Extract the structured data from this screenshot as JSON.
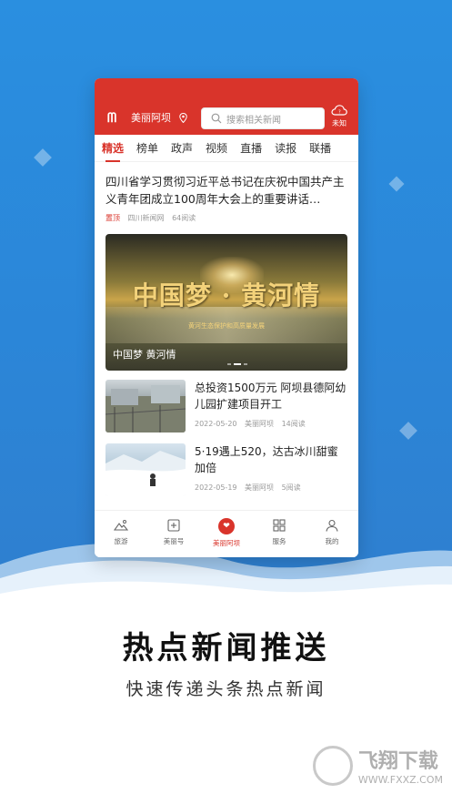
{
  "header": {
    "app_name": "美丽阿坝",
    "search_placeholder": "搜索相关新闻",
    "weather_label": "未知"
  },
  "tabs": [
    {
      "label": "精选",
      "active": true
    },
    {
      "label": "榜单"
    },
    {
      "label": "政声"
    },
    {
      "label": "视频"
    },
    {
      "label": "直播"
    },
    {
      "label": "读报"
    },
    {
      "label": "联播"
    }
  ],
  "top_news": {
    "title": "四川省学习贯彻习近平总书记在庆祝中国共产主义青年团成立100周年大会上的重要讲话…",
    "tag": "置顶",
    "source": "四川新闻网",
    "reads": "64阅读"
  },
  "banner": {
    "big_text": "中国梦 · 黄河情",
    "sub_text": "黄河生态保护和高质量发展",
    "caption": "中国梦 黄河情"
  },
  "news_list": [
    {
      "title": "总投资1500万元 阿坝县德阿幼儿园扩建项目开工",
      "date": "2022-05-20",
      "source": "美丽阿坝",
      "reads": "14阅读"
    },
    {
      "title": "5·19遇上520，达古冰川甜蜜加倍",
      "date": "2022-05-19",
      "source": "美丽阿坝",
      "reads": "5阅读"
    }
  ],
  "bottom_nav": [
    {
      "label": "旅游",
      "icon": "mountain-icon"
    },
    {
      "label": "美丽号",
      "icon": "plus-square-icon"
    },
    {
      "label": "美丽阿坝",
      "icon": "heart-icon",
      "active": true
    },
    {
      "label": "服务",
      "icon": "grid-icon"
    },
    {
      "label": "我的",
      "icon": "user-icon"
    }
  ],
  "promo": {
    "headline": "热点新闻推送",
    "subline": "快速传递头条热点新闻"
  },
  "watermark": {
    "cn": "飞翔下载",
    "url": "WWW.FXXZ.COM"
  },
  "colors": {
    "brand_red": "#d9342b",
    "bg_blue": "#2a8fe0"
  }
}
